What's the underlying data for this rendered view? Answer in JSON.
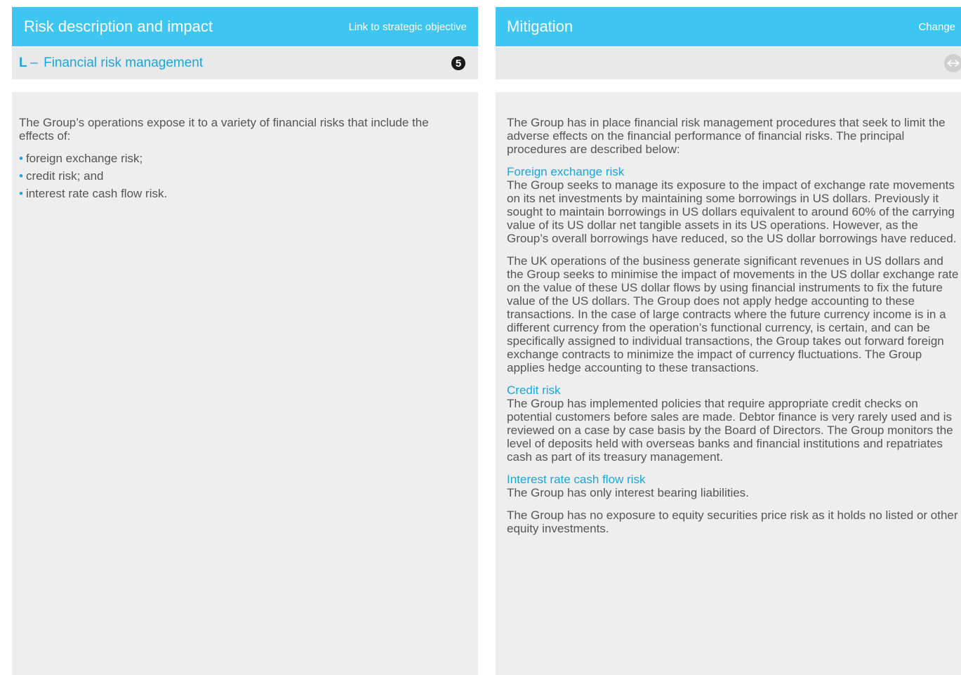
{
  "left": {
    "header_title": "Risk description and impact",
    "header_link": "Link to strategic objective",
    "risk_letter": "L",
    "risk_dash": "–",
    "risk_title": "Financial risk management",
    "objective_number": "5",
    "intro": "The Group’s operations expose it to a variety of financial risks that include the effects of:",
    "bullets": [
      "foreign exchange risk;",
      "credit risk; and",
      "interest rate cash flow risk."
    ]
  },
  "right": {
    "header_title": "Mitigation",
    "header_link": "Change",
    "change_icon": "arrows-left-right-icon",
    "intro": "The Group has in place financial risk management procedures that seek to limit the adverse effects on the financial performance of financial risks. The principal procedures are described below:",
    "sections": [
      {
        "heading": "Foreign exchange risk",
        "paragraphs": [
          "The Group seeks to manage its exposure to the impact of exchange rate movements on its net investments by maintaining some borrowings in US dollars. Previously it sought to maintain borrowings in US dollars equivalent to around 60% of the carrying value of its US dollar net tangible assets in its US operations. However, as the Group’s overall borrowings have reduced, so the US dollar borrowings have reduced.",
          "The UK operations of the business generate significant revenues in US dollars and the Group seeks to minimise the impact of movements in the US dollar exchange rate on the value of these US dollar flows by using financial instruments to fix the future value of the US dollars. The Group does not apply hedge accounting to these transactions. In the case of large contracts where the future currency income is in a different currency from the operation’s functional currency, is certain, and can be specifically assigned to individual transactions, the Group takes out forward foreign exchange contracts to minimize the impact of currency fluctuations. The Group applies hedge accounting to these transactions."
        ]
      },
      {
        "heading": "Credit risk",
        "paragraphs": [
          "The Group has implemented policies that require appropriate credit checks on potential customers before sales are made. Debtor finance is very rarely used and is reviewed on a case by case basis by the Board of Directors. The Group monitors the level of deposits held with overseas banks and financial institutions and repatriates cash as part of its treasury management."
        ]
      },
      {
        "heading": "Interest rate cash flow risk",
        "paragraphs": [
          "The Group has only interest bearing liabilities.",
          "The Group has no exposure to equity securities price risk as it holds no listed or other equity investments."
        ]
      }
    ]
  }
}
